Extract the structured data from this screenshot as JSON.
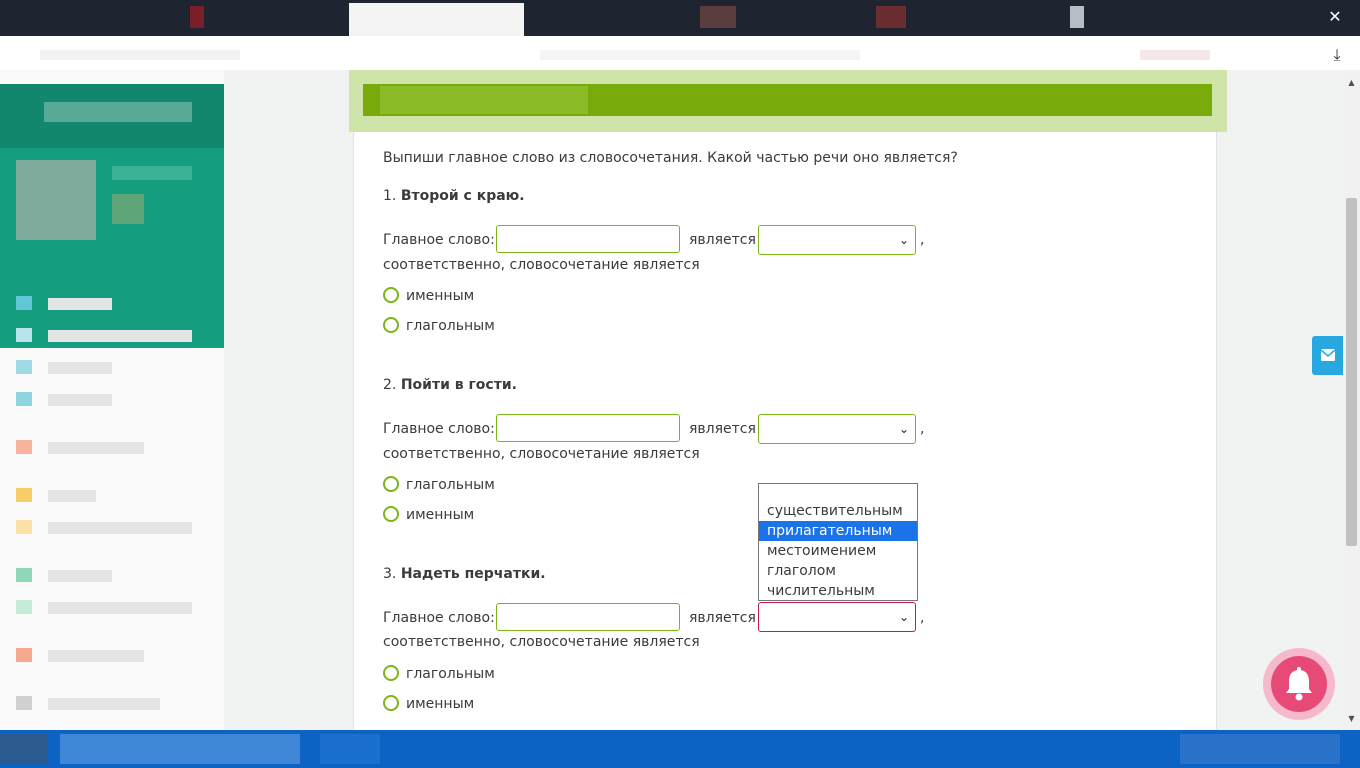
{
  "browser": {
    "close_glyph": "✕",
    "download_glyph": "⤓"
  },
  "task": {
    "instruction": "Выпиши главное слово из словосочетания. Какой частью речи оно является?",
    "main_word_label": "Главное слово:",
    "is_label": "является",
    "comma": ",",
    "consequently_label": "соответственно, словосочетание является",
    "items": [
      {
        "number": "1.",
        "phrase": "Второй с краю.",
        "options": [
          "именным",
          "глагольным"
        ]
      },
      {
        "number": "2.",
        "phrase": "Пойти в гости.",
        "options": [
          "глагольным",
          "именным"
        ]
      },
      {
        "number": "3.",
        "phrase": "Надеть перчатки.",
        "options": [
          "глагольным",
          "именным"
        ]
      }
    ]
  },
  "dropdown": {
    "options": [
      "",
      "существительным",
      "прилагательным",
      "местоимением",
      "глаголом",
      "числительным"
    ],
    "highlighted": "прилагательным"
  },
  "icons": {
    "select_arrow": "chevron-down-icon",
    "mail": "mail-icon",
    "bell": "bell-icon"
  },
  "colors": {
    "accent_green": "#7cb518",
    "header_green": "#78ab0a",
    "highlight_blue": "#1a73e8",
    "focus_border": "#c2185b",
    "bell_pink": "#e84a78",
    "mail_blue": "#29a8e0"
  }
}
